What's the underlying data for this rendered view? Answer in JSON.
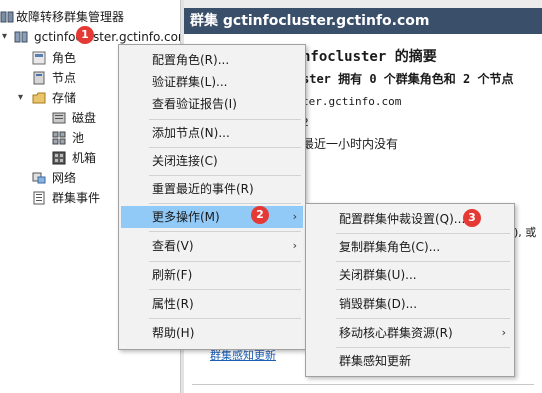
{
  "tree": {
    "root_label": "故障转移群集管理器",
    "cluster_label": "gctinfocluster.gctinfo.con",
    "items": [
      {
        "label": "角色",
        "icon": "roles-icon"
      },
      {
        "label": "节点",
        "icon": "nodes-icon"
      },
      {
        "label": "存储",
        "icon": "storage-folder-icon"
      },
      {
        "label": "磁盘",
        "icon": "disk-icon"
      },
      {
        "label": "池",
        "icon": "pool-icon"
      },
      {
        "label": "机箱",
        "icon": "enclosure-icon"
      },
      {
        "label": "网络",
        "icon": "network-icon"
      },
      {
        "label": "群集事件",
        "icon": "events-icon"
      }
    ]
  },
  "right_pane": {
    "title": "群集 gctinfocluster.gctinfo.com",
    "summary_heading": "nfocluster 的摘要",
    "summary_line": "ster 拥有 0 个群集角色和 2 个节点",
    "domain_line": "ter.gctinfo.com",
    "nodes_line": "2",
    "events_line": "最近一小时内没有",
    "partial_text": "), 或",
    "link_text": "群集感知更新"
  },
  "context_menu": {
    "items": [
      "配置角色(R)...",
      "验证群集(L)...",
      "查看验证报告(I)",
      "添加节点(N)...",
      "关闭连接(C)",
      "重置最近的事件(R)",
      "更多操作(M)",
      "查看(V)",
      "刷新(F)",
      "属性(R)",
      "帮助(H)"
    ]
  },
  "submenu": {
    "items": [
      "配置群集仲裁设置(Q)...",
      "复制群集角色(C)...",
      "关闭群集(U)...",
      "销毁群集(D)...",
      "移动核心群集资源(R)",
      "群集感知更新"
    ]
  },
  "badges": [
    "1",
    "2",
    "3"
  ],
  "colors": {
    "header_bg": "#3a4f6a",
    "highlight": "#91c9f7",
    "badge": "#e53935",
    "menu_bg": "#f2f2f2"
  }
}
